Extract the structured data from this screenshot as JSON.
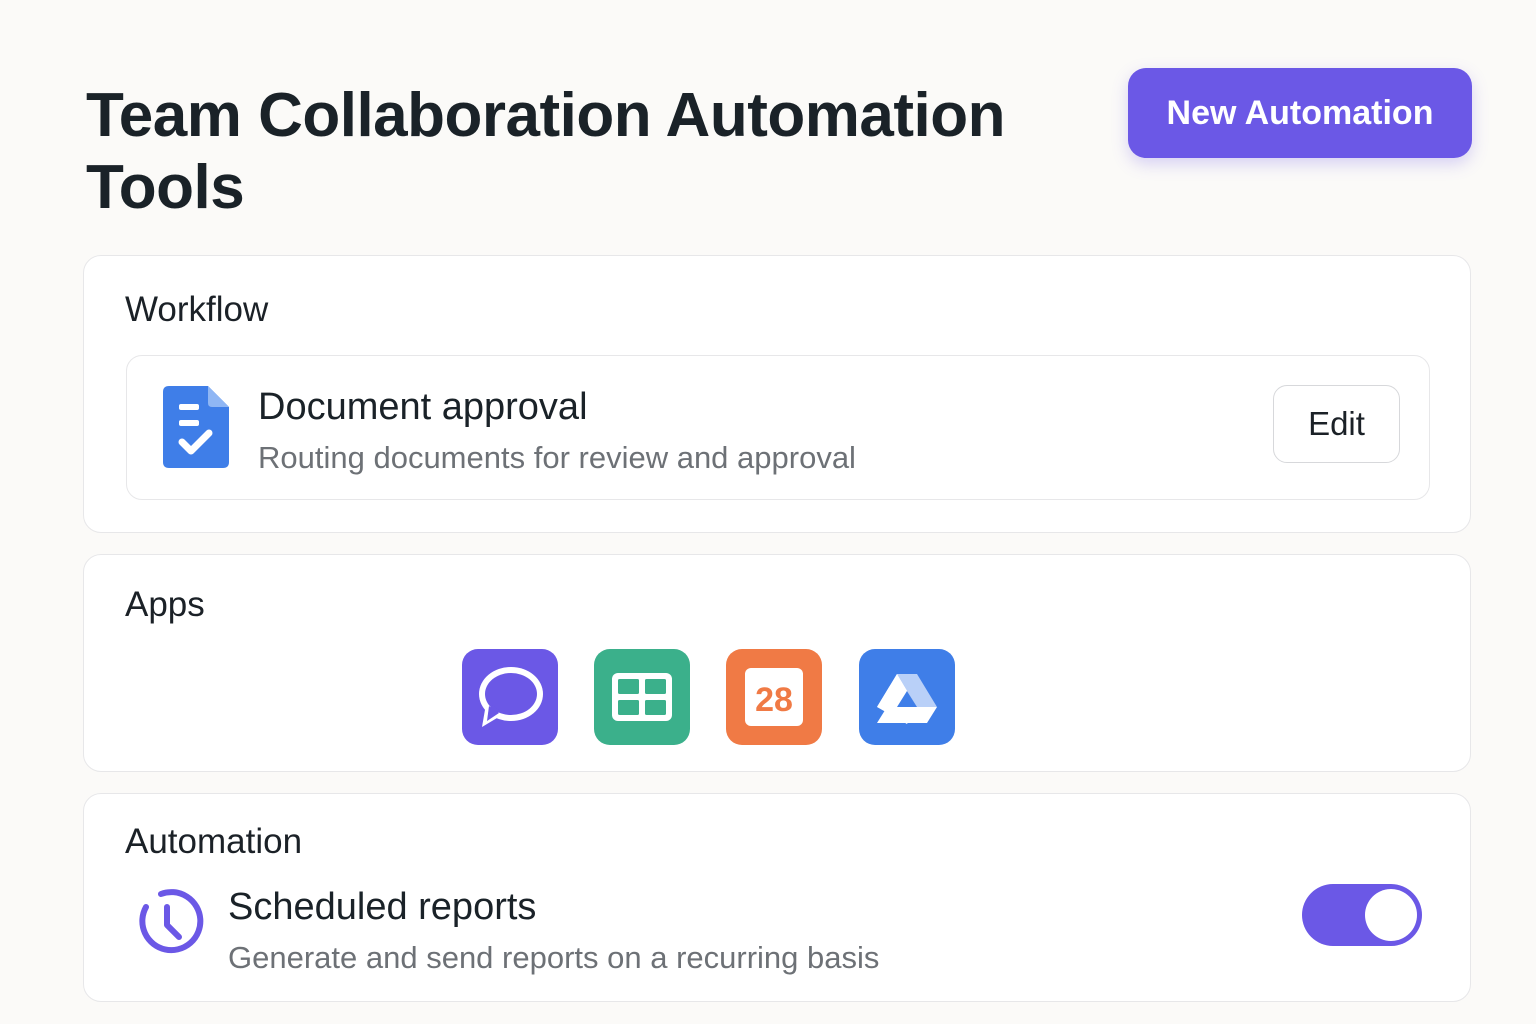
{
  "header": {
    "title": "Team Collaboration Automation Tools",
    "new_automation_label": "New Automation"
  },
  "workflow": {
    "section_title": "Workflow",
    "item": {
      "icon": "document-check-icon",
      "title": "Document approval",
      "description": "Routing documents for review and approval",
      "edit_label": "Edit"
    }
  },
  "apps": {
    "section_title": "Apps",
    "items": [
      {
        "icon": "chat-icon",
        "color": "#6b58e6"
      },
      {
        "icon": "spreadsheet-icon",
        "color": "#3bb08b"
      },
      {
        "icon": "calendar-icon",
        "label": "28",
        "color": "#f07a45"
      },
      {
        "icon": "drive-icon",
        "color": "#3f7ee8"
      }
    ]
  },
  "automation": {
    "section_title": "Automation",
    "item": {
      "icon": "clock-icon",
      "title": "Scheduled reports",
      "description": "Generate and send reports on a recurring basis",
      "enabled": true
    }
  },
  "colors": {
    "accent": "#6b58e6",
    "background": "#fbfaf8",
    "text": "#1b2127",
    "muted_text": "#6d7176"
  }
}
